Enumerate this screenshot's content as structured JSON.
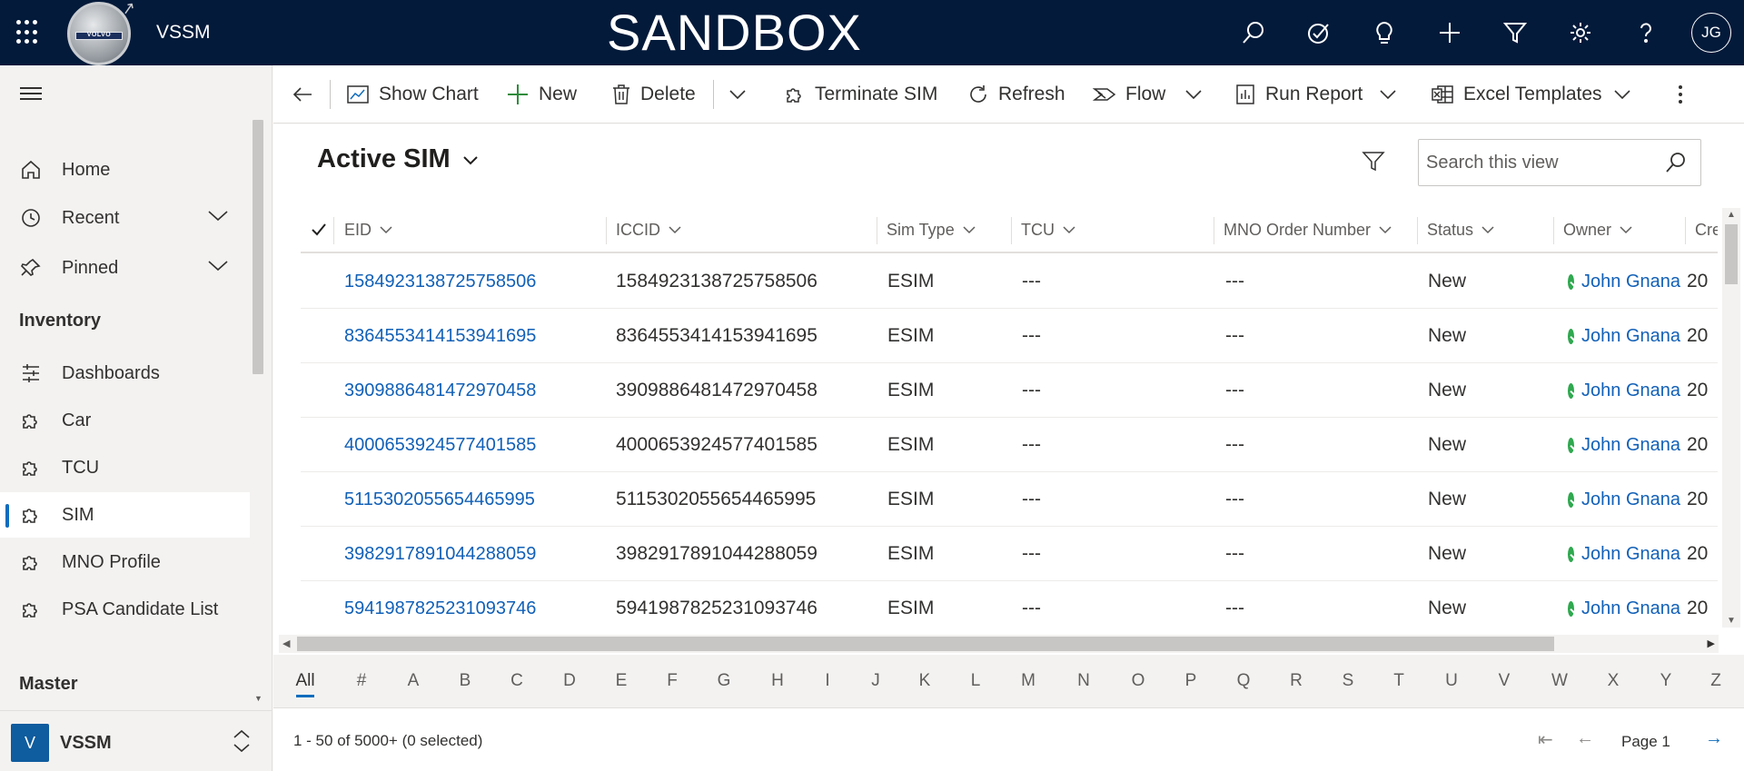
{
  "topbar": {
    "app_name": "VSSM",
    "environment": "SANDBOX",
    "logo_text": "VOLVO",
    "user_initials": "JG",
    "icons": [
      "search-icon",
      "task-icon",
      "lightbulb-icon",
      "plus-icon",
      "filter-icon",
      "gear-icon",
      "help-icon"
    ]
  },
  "sidebar": {
    "items": [
      {
        "label": "Home",
        "icon": "home-icon"
      },
      {
        "label": "Recent",
        "icon": "clock-icon",
        "expandable": true
      },
      {
        "label": "Pinned",
        "icon": "pin-icon",
        "expandable": true
      }
    ],
    "groups": [
      {
        "title": "Inventory",
        "items": [
          {
            "label": "Dashboards",
            "icon": "dashboard-icon"
          },
          {
            "label": "Car",
            "icon": "puzzle-icon"
          },
          {
            "label": "TCU",
            "icon": "puzzle-icon"
          },
          {
            "label": "SIM",
            "icon": "puzzle-icon",
            "active": true
          },
          {
            "label": "MNO Profile",
            "icon": "puzzle-icon"
          },
          {
            "label": "PSA Candidate List",
            "icon": "puzzle-icon"
          }
        ]
      },
      {
        "title": "Master",
        "items": []
      }
    ],
    "area": {
      "badge": "V",
      "label": "VSSM"
    }
  },
  "commandbar": {
    "show_chart": "Show Chart",
    "new": "New",
    "delete": "Delete",
    "terminate_sim": "Terminate SIM",
    "refresh": "Refresh",
    "flow": "Flow",
    "run_report": "Run Report",
    "excel_templates": "Excel Templates"
  },
  "view": {
    "title": "Active SIM",
    "search_placeholder": "Search this view"
  },
  "grid": {
    "columns": [
      "EID",
      "ICCID",
      "Sim Type",
      "TCU",
      "MNO Order Number",
      "Status",
      "Owner",
      "Cre"
    ],
    "rows": [
      {
        "eid": "1584923138725758506",
        "iccid": "1584923138725758506",
        "sim_type": "ESIM",
        "tcu": "---",
        "mno": "---",
        "status": "New",
        "owner": "John Gnana",
        "created": "20"
      },
      {
        "eid": "8364553414153941695",
        "iccid": "8364553414153941695",
        "sim_type": "ESIM",
        "tcu": "---",
        "mno": "---",
        "status": "New",
        "owner": "John Gnana",
        "created": "20"
      },
      {
        "eid": "3909886481472970458",
        "iccid": "3909886481472970458",
        "sim_type": "ESIM",
        "tcu": "---",
        "mno": "---",
        "status": "New",
        "owner": "John Gnana",
        "created": "20"
      },
      {
        "eid": "4000653924577401585",
        "iccid": "4000653924577401585",
        "sim_type": "ESIM",
        "tcu": "---",
        "mno": "---",
        "status": "New",
        "owner": "John Gnana",
        "created": "20"
      },
      {
        "eid": "5115302055654465995",
        "iccid": "5115302055654465995",
        "sim_type": "ESIM",
        "tcu": "---",
        "mno": "---",
        "status": "New",
        "owner": "John Gnana",
        "created": "20"
      },
      {
        "eid": "3982917891044288059",
        "iccid": "3982917891044288059",
        "sim_type": "ESIM",
        "tcu": "---",
        "mno": "---",
        "status": "New",
        "owner": "John Gnana",
        "created": "20"
      },
      {
        "eid": "5941987825231093746",
        "iccid": "5941987825231093746",
        "sim_type": "ESIM",
        "tcu": "---",
        "mno": "---",
        "status": "New",
        "owner": "John Gnana",
        "created": "20"
      }
    ]
  },
  "jumpbar": [
    "All",
    "#",
    "A",
    "B",
    "C",
    "D",
    "E",
    "F",
    "G",
    "H",
    "I",
    "J",
    "K",
    "L",
    "M",
    "N",
    "O",
    "P",
    "Q",
    "R",
    "S",
    "T",
    "U",
    "V",
    "W",
    "X",
    "Y",
    "Z"
  ],
  "footer": {
    "record_count": "1 - 50 of 5000+ (0 selected)",
    "page_label": "Page 1"
  },
  "colors": {
    "topbar_bg": "#031a3a",
    "link": "#1160b7",
    "accent": "#0f6cbd",
    "owner_status": "#2fa84f"
  }
}
